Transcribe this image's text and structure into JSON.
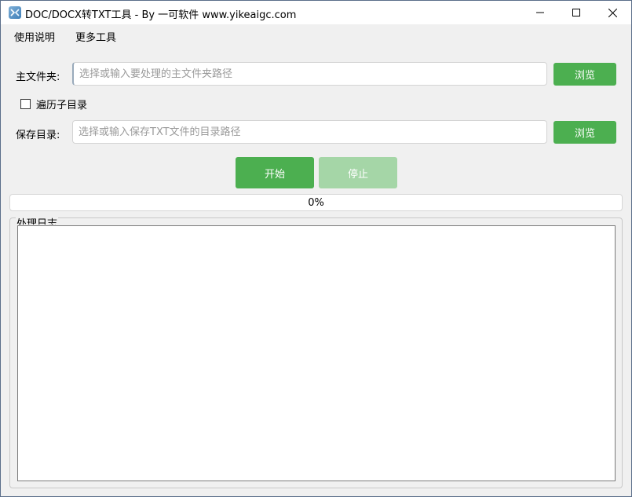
{
  "window": {
    "title": "DOC/DOCX转TXT工具 - By 一可软件 www.yikeaigc.com",
    "icon": "app-icon",
    "controls": [
      "minimize-icon",
      "maximize-icon",
      "close-icon"
    ]
  },
  "menu": {
    "items": [
      "使用说明",
      "更多工具"
    ]
  },
  "main_folder": {
    "label": "主文件夹:",
    "value": "",
    "placeholder": "选择或输入要处理的主文件夹路径",
    "browse_label": "浏览"
  },
  "recurse": {
    "label": "遍历子目录",
    "checked": false
  },
  "save_dir": {
    "label": "保存目录:",
    "value": "",
    "placeholder": "选择或输入保存TXT文件的目录路径",
    "browse_label": "浏览"
  },
  "actions": {
    "start_label": "开始",
    "stop_label": "停止",
    "stop_enabled": false
  },
  "progress": {
    "value": 0,
    "text": "0%"
  },
  "log": {
    "title": "处理日志",
    "content": ""
  },
  "colors": {
    "accent": "#4caf50",
    "accent_disabled": "#a5d6a7"
  }
}
